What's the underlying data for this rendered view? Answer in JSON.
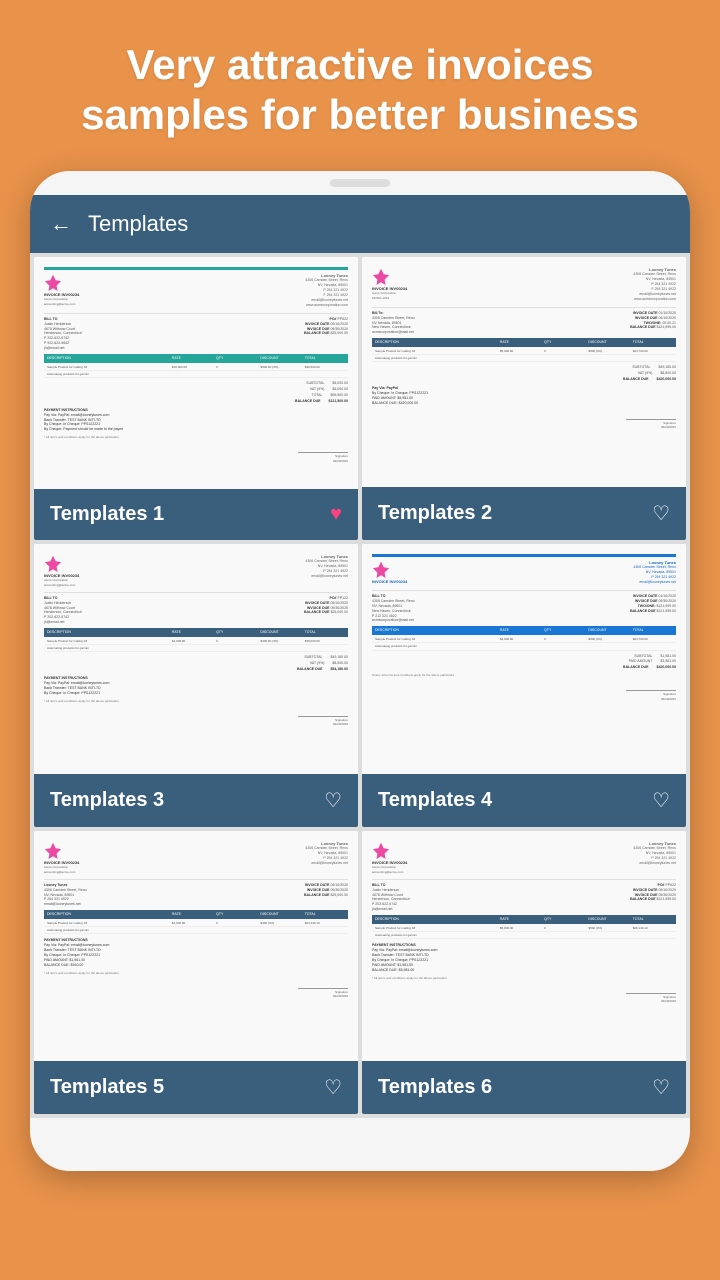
{
  "hero": {
    "title": "Very attractive invoices samples for better business",
    "background_color": "#E8924A"
  },
  "app": {
    "header": {
      "title": "Templates",
      "back_label": "←"
    }
  },
  "templates": [
    {
      "id": 1,
      "name": "Templates 1",
      "favorited": true,
      "accent": "teal"
    },
    {
      "id": 2,
      "name": "Templates 2",
      "favorited": false,
      "accent": "dark"
    },
    {
      "id": 3,
      "name": "Templates 3",
      "favorited": false,
      "accent": "dark"
    },
    {
      "id": 4,
      "name": "Templates 4",
      "favorited": false,
      "accent": "blue"
    },
    {
      "id": 5,
      "name": "Templates 5",
      "favorited": false,
      "accent": "dark"
    },
    {
      "id": 6,
      "name": "Templates 6",
      "favorited": false,
      "accent": "dark"
    }
  ]
}
